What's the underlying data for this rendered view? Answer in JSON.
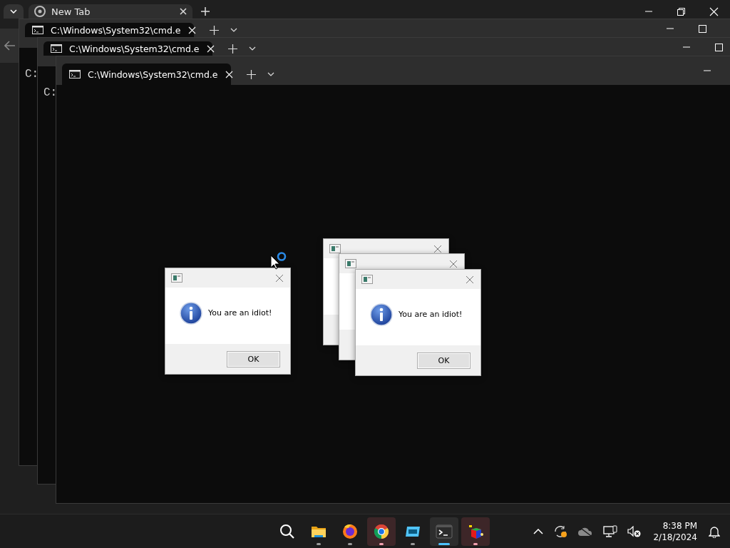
{
  "browser": {
    "tabs": [
      {
        "title": "New Tab",
        "selected": true
      }
    ]
  },
  "terminals": [
    {
      "tab_title": "C:\\Windows\\System32\\cmd.e",
      "prompt": "C:"
    },
    {
      "tab_title": "C:\\Windows\\System32\\cmd.e",
      "prompt": "C:"
    },
    {
      "tab_title": "C:\\Windows\\System32\\cmd.e"
    }
  ],
  "dialogs": [
    {
      "message": "You are an idiot!",
      "button": "OK"
    },
    {
      "kind": "covered"
    },
    {
      "kind": "covered"
    },
    {
      "message": "You are an idiot!",
      "button": "OK"
    }
  ],
  "taskbar": {
    "apps": [
      {
        "kind": "search",
        "selected": false,
        "running": false,
        "attention": false
      },
      {
        "kind": "folder",
        "selected": false,
        "running": true,
        "attention": false
      },
      {
        "kind": "fox",
        "selected": false,
        "running": true,
        "attention": false
      },
      {
        "kind": "ring",
        "selected": false,
        "running": true,
        "attention": true
      },
      {
        "kind": "panel",
        "selected": false,
        "running": true,
        "attention": false
      },
      {
        "kind": "terminal",
        "selected": true,
        "running": true,
        "attention": false
      },
      {
        "kind": "cube",
        "selected": false,
        "running": true,
        "attention": true
      }
    ],
    "time": "8:38 PM",
    "date": "2/18/2024"
  }
}
